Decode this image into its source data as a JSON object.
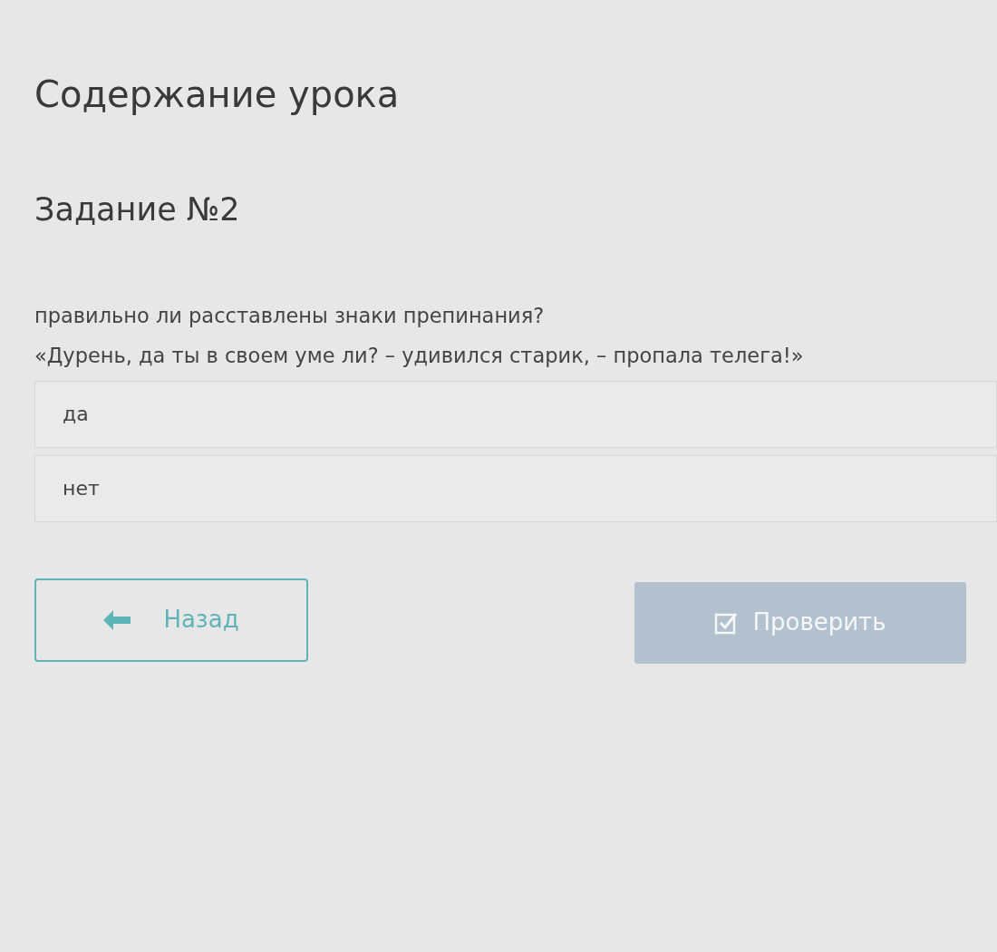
{
  "page_title": "Содержание урока",
  "task_title": "Задание №2",
  "question": [
    "правильно ли расставлены знаки препинания?",
    "«Дурень, да ты в своем уме ли? – удивился старик, – пропала телега!»"
  ],
  "options": [
    {
      "label": "да",
      "selected": false
    },
    {
      "label": "нет",
      "selected": false
    }
  ],
  "back_button": {
    "label": "Назад"
  },
  "check_button": {
    "label": "Проверить",
    "disabled": true
  }
}
